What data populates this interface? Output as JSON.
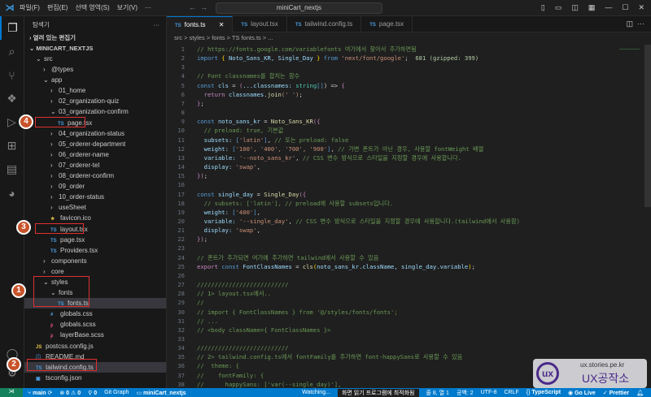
{
  "titlebar": {
    "menus": [
      "파일(F)",
      "편집(E)",
      "선택 영역(S)",
      "보기(V)",
      "···"
    ],
    "search": "miniCart_nextjs"
  },
  "sidebar": {
    "title": "탐색기",
    "more": "···",
    "open_editors": "열려 있는 편집기",
    "project": "MINICART_NEXTJS",
    "rows": [
      {
        "label": "src",
        "depth": 0,
        "kind": "open"
      },
      {
        "label": "@types",
        "depth": 1,
        "kind": "closed"
      },
      {
        "label": "app",
        "depth": 1,
        "kind": "open"
      },
      {
        "label": "01_home",
        "depth": 2,
        "kind": "closed"
      },
      {
        "label": "02_organization-quiz",
        "depth": 2,
        "kind": "closed"
      },
      {
        "label": "03_organization-confirm",
        "depth": 2,
        "kind": "open"
      },
      {
        "label": "page.tsx",
        "depth": 3,
        "kind": "ts"
      },
      {
        "label": "04_organization-status",
        "depth": 2,
        "kind": "closed"
      },
      {
        "label": "05_orderer-department",
        "depth": 2,
        "kind": "closed"
      },
      {
        "label": "06_orderer-name",
        "depth": 2,
        "kind": "closed"
      },
      {
        "label": "07_orderer-tel",
        "depth": 2,
        "kind": "closed"
      },
      {
        "label": "08_orderer-confirm",
        "depth": 2,
        "kind": "closed"
      },
      {
        "label": "09_order",
        "depth": 2,
        "kind": "closed"
      },
      {
        "label": "10_order-status",
        "depth": 2,
        "kind": "closed"
      },
      {
        "label": "useSheet",
        "depth": 2,
        "kind": "closed"
      },
      {
        "label": "favicon.ico",
        "depth": 2,
        "kind": "star"
      },
      {
        "label": "layout.tsx",
        "depth": 2,
        "kind": "ts"
      },
      {
        "label": "page.tsx",
        "depth": 2,
        "kind": "ts"
      },
      {
        "label": "Providers.tsx",
        "depth": 2,
        "kind": "ts"
      },
      {
        "label": "components",
        "depth": 1,
        "kind": "closed"
      },
      {
        "label": "core",
        "depth": 1,
        "kind": "closed"
      },
      {
        "label": "styles",
        "depth": 1,
        "kind": "open"
      },
      {
        "label": "fonts",
        "depth": 2,
        "kind": "open"
      },
      {
        "label": "fonts.ts",
        "depth": 3,
        "kind": "ts",
        "selected": true
      },
      {
        "label": "globals.css",
        "depth": 2,
        "kind": "css"
      },
      {
        "label": "globals.scss",
        "depth": 2,
        "kind": "scss"
      },
      {
        "label": "layerBase.scss",
        "depth": 2,
        "kind": "scss"
      },
      {
        "label": "postcss.config.js",
        "depth": 0,
        "kind": "js"
      },
      {
        "label": "README.md",
        "depth": 0,
        "kind": "info"
      },
      {
        "label": "tailwind.config.ts",
        "depth": 0,
        "kind": "ts",
        "selected": true
      },
      {
        "label": "tsconfig.json",
        "depth": 0,
        "kind": "json"
      }
    ]
  },
  "tabs": [
    {
      "label": "fonts.ts",
      "active": true
    },
    {
      "label": "layout.tsx"
    },
    {
      "label": "tailwind.config.ts"
    },
    {
      "label": "page.tsx"
    }
  ],
  "breadcrumb": "src > styles > fonts > TS fonts.ts > ...",
  "code": [
    [
      [
        "// ",
        "c"
      ],
      [
        "https://fonts.google.com/variablefonts",
        "c"
      ],
      [
        " 여기에서 찾아서 추가하면됨",
        "c"
      ]
    ],
    [
      [
        "import ",
        "k"
      ],
      [
        "{ ",
        "p"
      ],
      [
        "Noto_Sans_KR, Single_Day ",
        "v"
      ],
      [
        "} ",
        "p"
      ],
      [
        "from ",
        "k"
      ],
      [
        "'next/font/google'",
        "s"
      ],
      [
        ";  ",
        "w"
      ],
      [
        "681 (gzipped: 399)",
        "n"
      ]
    ],
    [],
    [
      [
        "// Font classnames를 합치는 함수",
        "c"
      ]
    ],
    [
      [
        "const ",
        "k"
      ],
      [
        "cls ",
        "v"
      ],
      [
        "= ",
        "w"
      ],
      [
        "(",
        "m"
      ],
      [
        "...classnames: ",
        "v"
      ],
      [
        "string",
        "t"
      ],
      [
        "[]",
        "k"
      ],
      [
        ") => ",
        "w"
      ],
      [
        "{",
        "m"
      ]
    ],
    [
      [
        "  return ",
        "m"
      ],
      [
        "classnames.",
        "v"
      ],
      [
        "join",
        "f"
      ],
      [
        "(' ')",
        "s"
      ],
      [
        ";",
        "w"
      ]
    ],
    [
      [
        "}",
        "m"
      ],
      [
        ";",
        "w"
      ]
    ],
    [],
    [
      [
        "const ",
        "k"
      ],
      [
        "noto_sans_kr ",
        "v"
      ],
      [
        "= ",
        "w"
      ],
      [
        "Noto_Sans_KR",
        "f"
      ],
      [
        "({",
        "m"
      ]
    ],
    [
      [
        "  // preload: true, 기본값",
        "c"
      ]
    ],
    [
      [
        "  subsets: ",
        "v"
      ],
      [
        "[",
        "k"
      ],
      [
        "'latin'",
        "s"
      ],
      [
        "]",
        "k"
      ],
      [
        ", ",
        "w"
      ],
      [
        "// 또는 preload: false",
        "c"
      ]
    ],
    [
      [
        "  weight: ",
        "v"
      ],
      [
        "[",
        "k"
      ],
      [
        "'100', '400', '700', '900'",
        "s"
      ],
      [
        "]",
        "k"
      ],
      [
        ", ",
        "w"
      ],
      [
        "// 가변 폰트가 아닌 경우, 사용할 fontWeight 배열",
        "c"
      ]
    ],
    [
      [
        "  variable: ",
        "v"
      ],
      [
        "'--noto_sans_kr'",
        "s"
      ],
      [
        ", ",
        "w"
      ],
      [
        "// CSS 변수 방식으로 스타일을 지정할 경우에 사용합니다.",
        "c"
      ]
    ],
    [
      [
        "  display: ",
        "v"
      ],
      [
        "'swap'",
        "s"
      ],
      [
        ",",
        "w"
      ]
    ],
    [
      [
        "})",
        "m"
      ],
      [
        ";",
        "w"
      ]
    ],
    [],
    [
      [
        "const ",
        "k"
      ],
      [
        "single_day ",
        "v"
      ],
      [
        "= ",
        "w"
      ],
      [
        "Single_Day",
        "f"
      ],
      [
        "({",
        "m"
      ]
    ],
    [
      [
        "  // subsets: ['latin'], // preload에 사용할 subsets입니다.",
        "c"
      ]
    ],
    [
      [
        "  weight: ",
        "v"
      ],
      [
        "[",
        "k"
      ],
      [
        "'400'",
        "s"
      ],
      [
        "]",
        "k"
      ],
      [
        ",",
        "w"
      ]
    ],
    [
      [
        "  variable: ",
        "v"
      ],
      [
        "'--single_day'",
        "s"
      ],
      [
        ", ",
        "w"
      ],
      [
        "// CSS 변수 방식으로 스타일을 지정할 경우에 사용합니다.(tailwind에서 사용함)",
        "c"
      ]
    ],
    [
      [
        "  display: ",
        "v"
      ],
      [
        "'swap'",
        "s"
      ],
      [
        ",",
        "w"
      ]
    ],
    [
      [
        "})",
        "m"
      ],
      [
        ";",
        "w"
      ]
    ],
    [],
    [
      [
        "// 폰트가 추가되면 여기에 추가하면 tailwind에서 사용할 수 있음",
        "c"
      ]
    ],
    [
      [
        "export ",
        "m"
      ],
      [
        "const ",
        "k"
      ],
      [
        "FontClassNames ",
        "v"
      ],
      [
        "= ",
        "w"
      ],
      [
        "cls",
        "f"
      ],
      [
        "(",
        "p"
      ],
      [
        "noto_sans_kr.className, single_day.variable",
        "v"
      ],
      [
        ")",
        "p"
      ],
      [
        ";",
        "w"
      ]
    ],
    [],
    [
      [
        "//////////////////////////",
        "c"
      ]
    ],
    [
      [
        "// 1> layout.tsx에서..",
        "c"
      ]
    ],
    [
      [
        "//",
        "c"
      ]
    ],
    [
      [
        "// import { FontClassNames } from '@/styles/fonts/fonts';",
        "c"
      ]
    ],
    [
      [
        "// ...",
        "c"
      ]
    ],
    [
      [
        "// <body className={ FontClassNames }>",
        "c"
      ]
    ],
    [],
    [
      [
        "//////////////////////////",
        "c"
      ]
    ],
    [
      [
        "// 2> tailwind.config.ts에서 fontFamily를 추가하면 font-happySans로 사용할 수 있음",
        "c"
      ]
    ],
    [
      [
        "//  theme: {",
        "c"
      ]
    ],
    [
      [
        "//    fontFamily: {",
        "c"
      ]
    ],
    [
      [
        "//      happySans: ['var(--single_day)'],",
        "c"
      ]
    ]
  ],
  "status": {
    "branch": "main",
    "errors": "0",
    "warnings": "0",
    "ports": "0",
    "git_graph": "Git Graph",
    "folder": "miniCart_nextjs",
    "watching": "Watching...",
    "screen_reader": "화면 읽기 프로그램에 최적화됨",
    "position": "줄 8, 열 1",
    "spaces": "공백: 2",
    "encoding": "UTF-8",
    "eol": "CRLF",
    "language": "TypeScript",
    "golive": "Go Live",
    "prettier": "Prettier"
  },
  "annotations": [
    "1",
    "2",
    "3",
    "4"
  ],
  "watermark": {
    "url": "ux.stories.pe.kr",
    "name": "UX공작소"
  },
  "colors": {
    "accent": "#007acc",
    "annotation": "#c8532a"
  }
}
